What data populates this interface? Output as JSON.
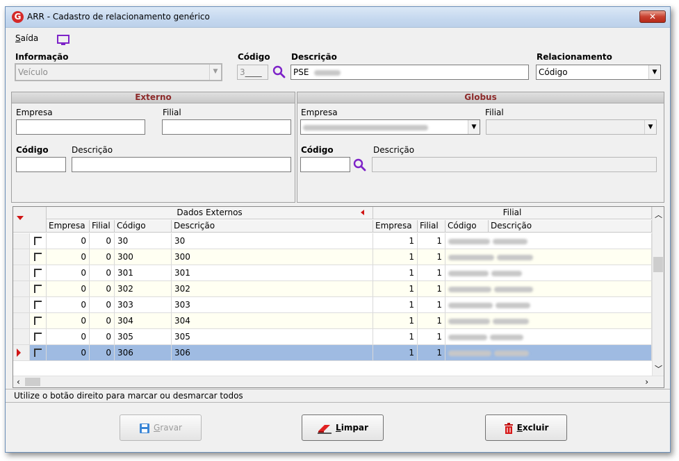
{
  "window": {
    "title": "ARR - Cadastro de relacionamento genérico",
    "logo_letter": "G",
    "close_glyph": "✕"
  },
  "menu": {
    "saida_prefix": "S",
    "saida_rest": "aída"
  },
  "top": {
    "informacao_label": "Informação",
    "informacao_value": "Veículo",
    "codigo_label": "Código",
    "codigo_value": "3",
    "descricao_label": "Descrição",
    "descricao_value": "PSE",
    "relacionamento_label": "Relacionamento",
    "relacionamento_value": "Código"
  },
  "externo": {
    "title": "Externo",
    "empresa_label": "Empresa",
    "filial_label": "Filial",
    "codigo_label": "Código",
    "descricao_label": "Descrição"
  },
  "globus": {
    "title": "Globus",
    "empresa_label": "Empresa",
    "filial_label": "Filial",
    "codigo_label": "Código",
    "descricao_label": "Descrição"
  },
  "grid": {
    "group_left": "Dados Externos",
    "group_right": "Filial",
    "columns": [
      "Empresa",
      "Filial",
      "Código",
      "Descrição",
      "Empresa",
      "Filial",
      "Código",
      "Descrição"
    ],
    "rows": [
      {
        "empresa": "0",
        "filial": "0",
        "codigo": "30",
        "descricao": "30",
        "g_empresa": "1",
        "g_filial": "1"
      },
      {
        "empresa": "0",
        "filial": "0",
        "codigo": "300",
        "descricao": "300",
        "g_empresa": "1",
        "g_filial": "1"
      },
      {
        "empresa": "0",
        "filial": "0",
        "codigo": "301",
        "descricao": "301",
        "g_empresa": "1",
        "g_filial": "1"
      },
      {
        "empresa": "0",
        "filial": "0",
        "codigo": "302",
        "descricao": "302",
        "g_empresa": "1",
        "g_filial": "1"
      },
      {
        "empresa": "0",
        "filial": "0",
        "codigo": "303",
        "descricao": "303",
        "g_empresa": "1",
        "g_filial": "1"
      },
      {
        "empresa": "0",
        "filial": "0",
        "codigo": "304",
        "descricao": "304",
        "g_empresa": "1",
        "g_filial": "1"
      },
      {
        "empresa": "0",
        "filial": "0",
        "codigo": "305",
        "descricao": "305",
        "g_empresa": "1",
        "g_filial": "1"
      },
      {
        "empresa": "0",
        "filial": "0",
        "codigo": "306",
        "descricao": "306",
        "g_empresa": "1",
        "g_filial": "1"
      }
    ],
    "selected_row": 7
  },
  "status": {
    "hint": "Utilize o botão direito para marcar ou desmarcar todos"
  },
  "buttons": {
    "gravar_u": "G",
    "gravar_rest": "ravar",
    "limpar_u": "L",
    "limpar_rest": "impar",
    "excluir_u": "E",
    "excluir_rest": "xcluir"
  },
  "colors": {
    "selection": "#9fbbe2",
    "highlight_border": "#d01515",
    "section_title": "#8c2a2a",
    "search_icon": "#7d22c8"
  }
}
